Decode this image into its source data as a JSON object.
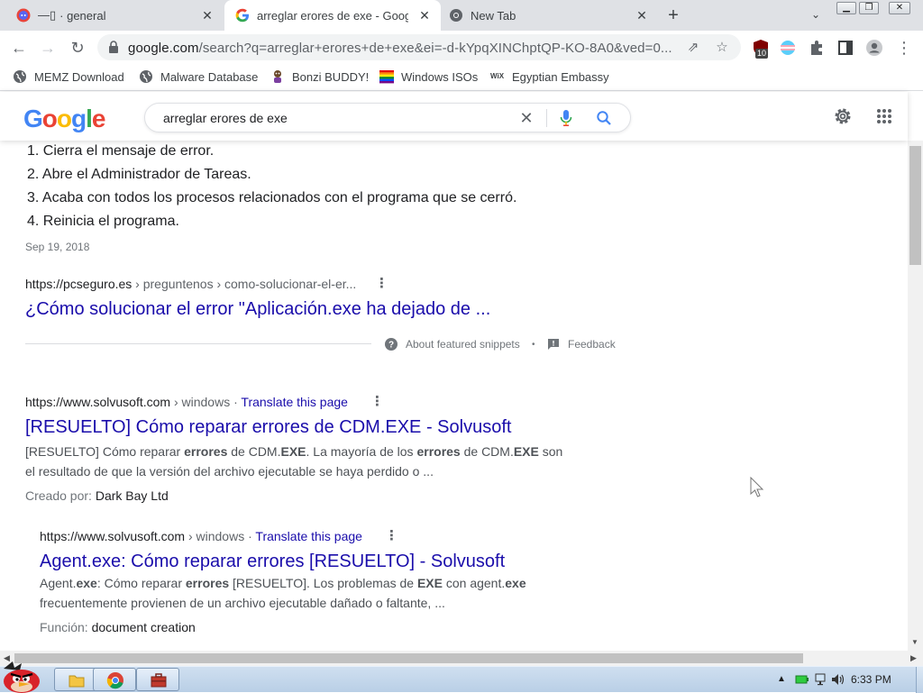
{
  "browser": {
    "tabs": [
      {
        "title": "· general",
        "icon": "discord-tab-icon"
      },
      {
        "title": "arreglar erores de exe - Google",
        "icon": "google-g-icon",
        "active": true
      },
      {
        "title": "New Tab",
        "icon": "chrome-icon"
      }
    ],
    "new_tab_label": "+",
    "url_host": "google.com",
    "url_path": "/search?q=arreglar+erores+de+exe&ei=-d-kYpqXINChptQP-KO-8A0&ved=0...",
    "extension_badge": "10",
    "bookmarks": [
      {
        "label": "MEMZ Download",
        "icon": "globe-icon"
      },
      {
        "label": "Malware Database",
        "icon": "globe-icon"
      },
      {
        "label": "Bonzi BUDDY!",
        "icon": "bonzi-icon"
      },
      {
        "label": "Windows ISOs",
        "icon": "rainbow-flag-icon"
      },
      {
        "label": "Egyptian Embassy",
        "icon": "wix-icon"
      }
    ]
  },
  "google": {
    "logo_letters": [
      "G",
      "o",
      "o",
      "g",
      "l",
      "e"
    ],
    "logo_colors": [
      "#4285f4",
      "#ea4335",
      "#fbbc05",
      "#4285f4",
      "#34a853",
      "#ea4335"
    ],
    "query": "arreglar erores de exe"
  },
  "results": {
    "steps": [
      "1. Cierra el mensaje de error.",
      "2. Abre el Administrador de Tareas.",
      "3. Acaba con todos los procesos relacionados con el programa que se cerró.",
      "4. Reinicia el programa."
    ],
    "snippet_date": "Sep 19, 2018",
    "featured": {
      "cite_host": "https://pcseguro.es",
      "cite_path": " › preguntenos › como-solucionar-el-er...",
      "title": "¿Cómo solucionar el error \"Aplicación.exe ha dejado de ..."
    },
    "about_snippets": "About featured snippets",
    "feedback": "Feedback",
    "translate_label": "Translate this page",
    "r1": {
      "cite_host": "https://www.solvusoft.com",
      "cite_path": " › windows",
      "title": "[RESUELTO] Cómo reparar errores de CDM.EXE - Solvusoft",
      "created_label": "Creado por:",
      "created_value": "Dark Bay Ltd"
    },
    "r2": {
      "cite_host": "https://www.solvusoft.com",
      "cite_path": " › windows",
      "title": "Agent.exe: Cómo reparar errores [RESUELTO] - Solvusoft",
      "func_label": "Función:",
      "func_value": "document creation"
    }
  },
  "taskbar": {
    "clock": "6:33 PM"
  }
}
